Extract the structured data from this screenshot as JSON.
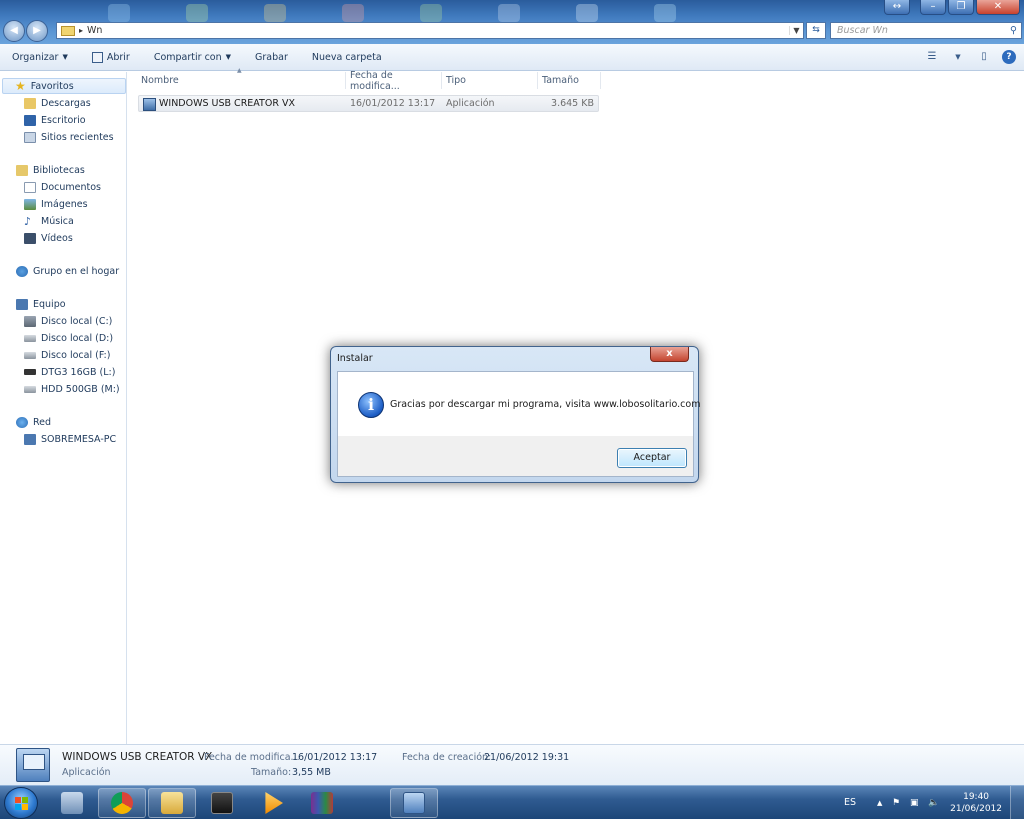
{
  "window": {
    "address_path": "Wn",
    "search_placeholder": "Buscar Wn",
    "controls": {
      "snap": "↔",
      "minimize": "–",
      "restore": "❐",
      "close": "✕"
    }
  },
  "toolbar": {
    "organize": "Organizar",
    "open": "Abrir",
    "share": "Compartir con",
    "burn": "Grabar",
    "new_folder": "Nueva carpeta",
    "help": "?"
  },
  "nav": {
    "favorites": "Favoritos",
    "downloads": "Descargas",
    "desktop": "Escritorio",
    "recent": "Sitios recientes",
    "libraries": "Bibliotecas",
    "documents": "Documentos",
    "pictures": "Imágenes",
    "music": "Música",
    "videos": "Vídeos",
    "homegroup": "Grupo en el hogar",
    "computer": "Equipo",
    "drive_c": "Disco local (C:)",
    "drive_d": "Disco local (D:)",
    "drive_f": "Disco local (F:)",
    "drive_l": "DTG3 16GB (L:)",
    "drive_m": "HDD 500GB (M:)",
    "network": "Red",
    "network_pc": "SOBREMESA-PC"
  },
  "columns": {
    "name": "Nombre",
    "modified": "Fecha de modifica...",
    "type": "Tipo",
    "size": "Tamaño"
  },
  "files": [
    {
      "name": "WINDOWS USB CREATOR VX",
      "modified": "16/01/2012 13:17",
      "type": "Aplicación",
      "size": "3.645 KB"
    }
  ],
  "details": {
    "name": "WINDOWS USB CREATOR VX",
    "kind": "Aplicación",
    "modified_label": "Fecha de modifica...",
    "modified_value": "16/01/2012 13:17",
    "created_label": "Fecha de creación:",
    "created_value": "21/06/2012 19:31",
    "size_label": "Tamaño:",
    "size_value": "3,55 MB"
  },
  "dialog": {
    "title": "Instalar",
    "close": "x",
    "icon": "i",
    "message": "Gracias por descargar mi programa, visita www.lobosolitario.com",
    "ok": "Aceptar"
  },
  "taskbar": {
    "lang": "ES",
    "time": "19:40",
    "date": "21/06/2012"
  },
  "icons": {
    "favorites": "star-icon",
    "taskbar_apps": [
      "system-icon",
      "chrome-icon",
      "explorer-icon",
      "media-center-icon",
      "media-player-icon",
      "winrar-icon",
      "installer-icon"
    ]
  }
}
